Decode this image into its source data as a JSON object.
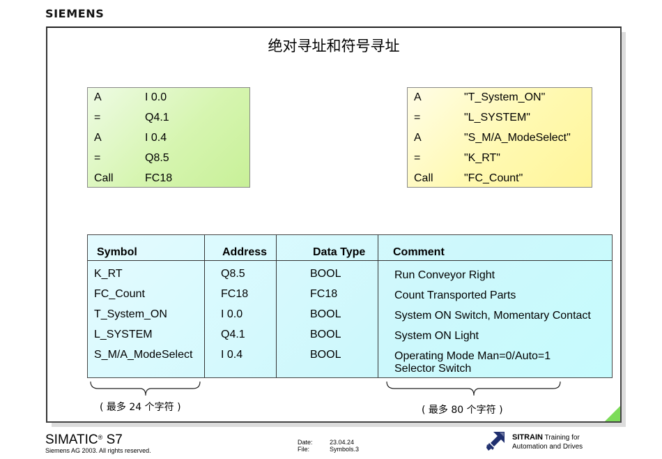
{
  "header": {
    "brand": "SIEMENS"
  },
  "slide": {
    "title": "绝对寻址和符号寻址",
    "absolute_code": [
      {
        "op": "A",
        "arg": "I 0.0"
      },
      {
        "op": "=",
        "arg": "Q4.1"
      },
      {
        "op": "A",
        "arg": "I 0.4"
      },
      {
        "op": "=",
        "arg": "Q8.5"
      },
      {
        "op": "Call",
        "arg": "FC18"
      }
    ],
    "symbolic_code": [
      {
        "op": "A",
        "arg": "\"T_System_ON\""
      },
      {
        "op": "=",
        "arg": "\"L_SYSTEM\""
      },
      {
        "op": "A",
        "arg": "\"S_M/A_ModeSelect\""
      },
      {
        "op": "=",
        "arg": "\"K_RT\""
      },
      {
        "op": "Call",
        "arg": "\"FC_Count\""
      }
    ],
    "symbol_table": {
      "headers": [
        "Symbol",
        "Address",
        "Data Type",
        "Comment"
      ],
      "rows": [
        {
          "symbol": "K_RT",
          "address": "Q8.5",
          "type": "BOOL",
          "comment": "Run Conveyor Right",
          "comment2": ""
        },
        {
          "symbol": "FC_Count",
          "address": "FC18",
          "type": "FC18",
          "comment": "Count Transported Parts",
          "comment2": ""
        },
        {
          "symbol": "T_System_ON",
          "address": "I 0.0",
          "type": "BOOL",
          "comment": "System ON Switch, Momentary Contact",
          "comment2": ""
        },
        {
          "symbol": "L_SYSTEM",
          "address": "Q4.1",
          "type": "BOOL",
          "comment": "System ON Light",
          "comment2": ""
        },
        {
          "symbol": "S_M/A_ModeSelect",
          "address": "I 0.4",
          "type": "BOOL",
          "comment": "Operating Mode Man=0/Auto=1",
          "comment2": "Selector Switch"
        }
      ]
    },
    "notes": {
      "symbol_limit": "( 最多  24  个字符 )",
      "comment_limit": "( 最多  80  个字符 )"
    },
    "colors": {
      "absolute_box": "#d6f5b0",
      "symbolic_box": "#fff9b0",
      "table": "#cdf8fc",
      "corner_accent": "#7ddc5a"
    }
  },
  "footer": {
    "product": "SIMATIC",
    "product_reg": "®",
    "product_suffix": " S7",
    "copyright": "Siemens AG 2003. All rights reserved.",
    "date_label": "Date:",
    "date_value": "23.04.24",
    "file_label": "File:",
    "file_value": "Symbols.3",
    "sitrain_brand": "SITRAIN",
    "sitrain_line1": " Training for",
    "sitrain_line2": "Automation and Drives"
  }
}
